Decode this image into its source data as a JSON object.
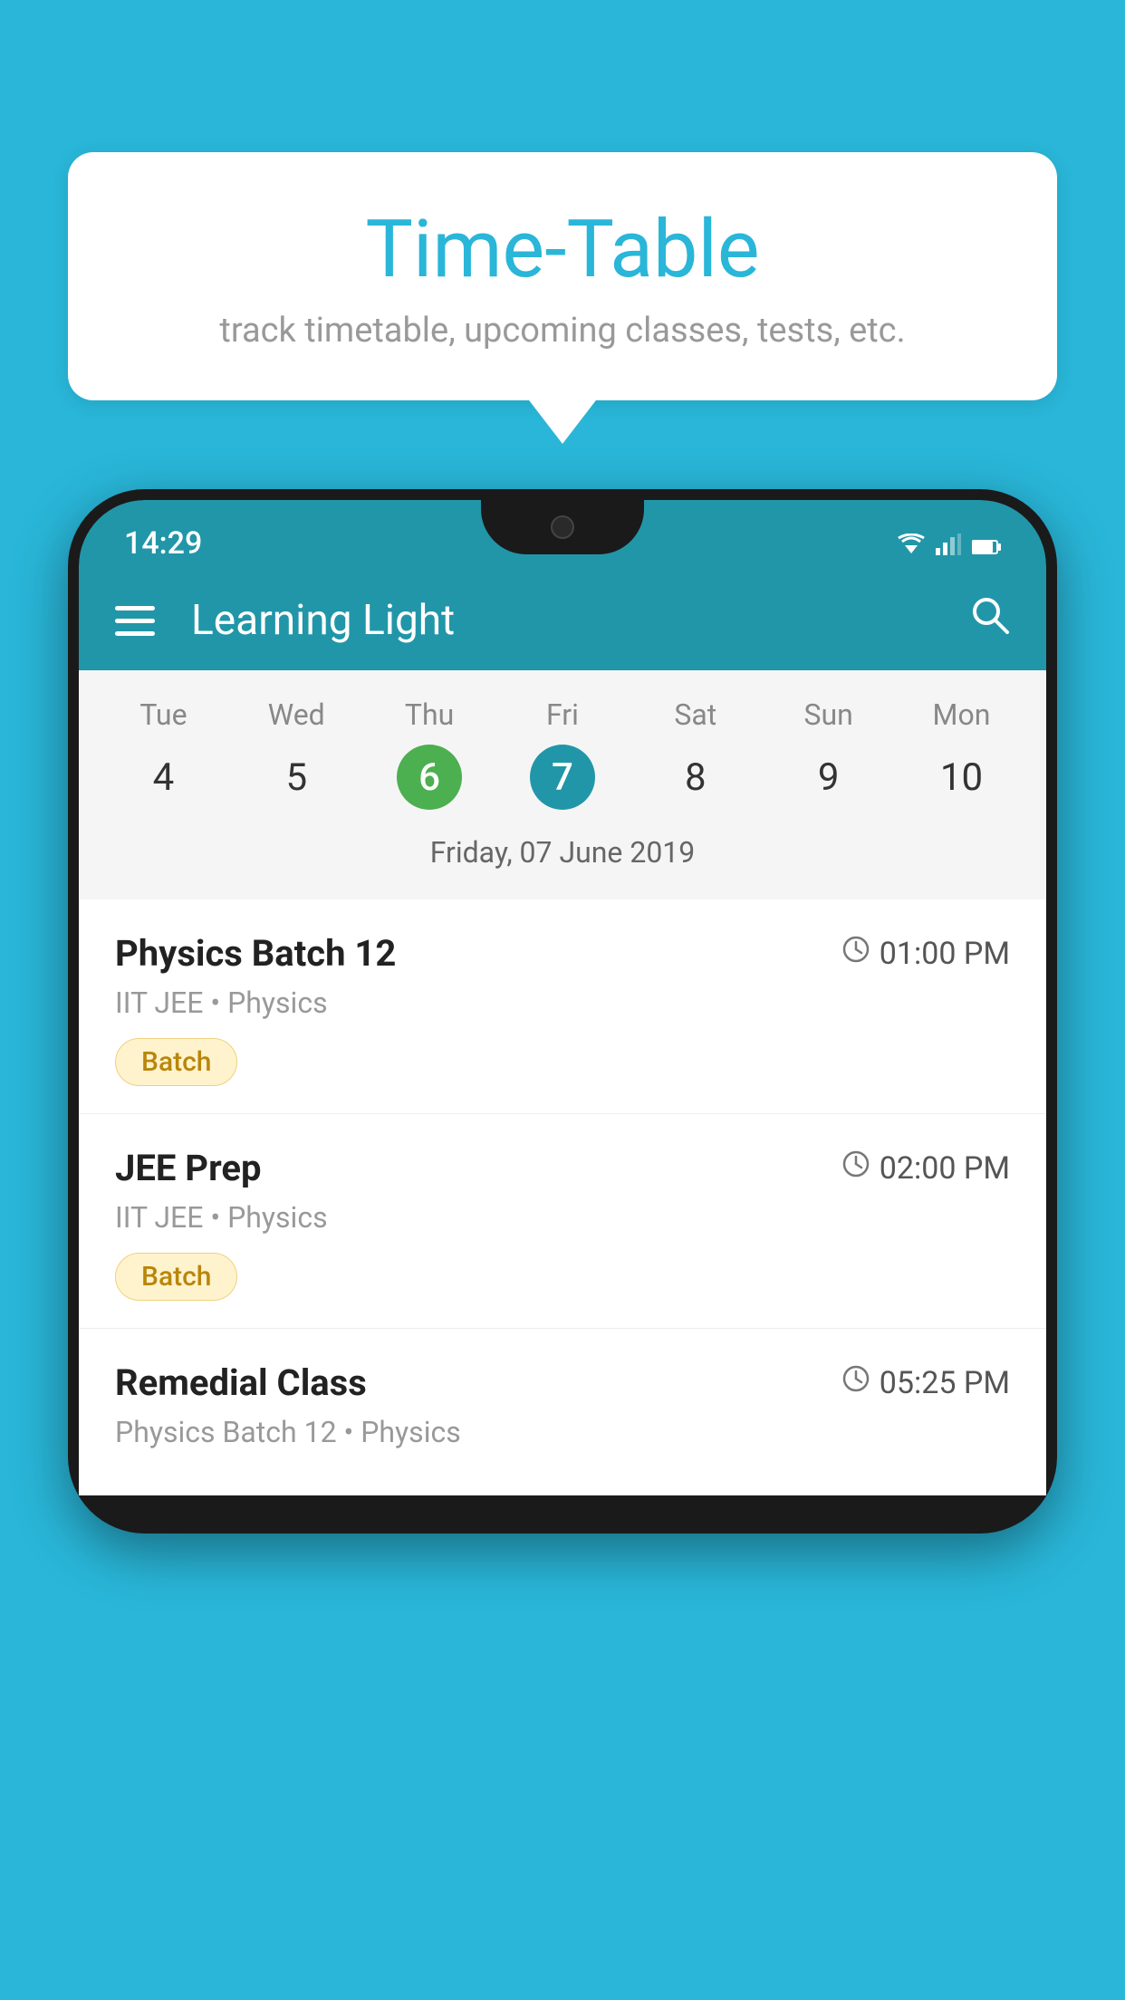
{
  "background_color": "#29b6d8",
  "bubble": {
    "title": "Time-Table",
    "subtitle": "track timetable, upcoming classes, tests, etc."
  },
  "phone": {
    "status_bar": {
      "time": "14:29"
    },
    "app_bar": {
      "title": "Learning Light"
    },
    "calendar": {
      "days": [
        {
          "name": "Tue",
          "num": "4",
          "state": "normal"
        },
        {
          "name": "Wed",
          "num": "5",
          "state": "normal"
        },
        {
          "name": "Thu",
          "num": "6",
          "state": "today"
        },
        {
          "name": "Fri",
          "num": "7",
          "state": "selected"
        },
        {
          "name": "Sat",
          "num": "8",
          "state": "normal"
        },
        {
          "name": "Sun",
          "num": "9",
          "state": "normal"
        },
        {
          "name": "Mon",
          "num": "10",
          "state": "normal"
        }
      ],
      "selected_date_label": "Friday, 07 June 2019"
    },
    "schedule": [
      {
        "name": "Physics Batch 12",
        "time": "01:00 PM",
        "sub": "IIT JEE • Physics",
        "tag": "Batch"
      },
      {
        "name": "JEE Prep",
        "time": "02:00 PM",
        "sub": "IIT JEE • Physics",
        "tag": "Batch"
      },
      {
        "name": "Remedial Class",
        "time": "05:25 PM",
        "sub": "Physics Batch 12 • Physics",
        "tag": null
      }
    ]
  },
  "icons": {
    "hamburger": "☰",
    "search": "🔍",
    "clock": "🕐"
  }
}
